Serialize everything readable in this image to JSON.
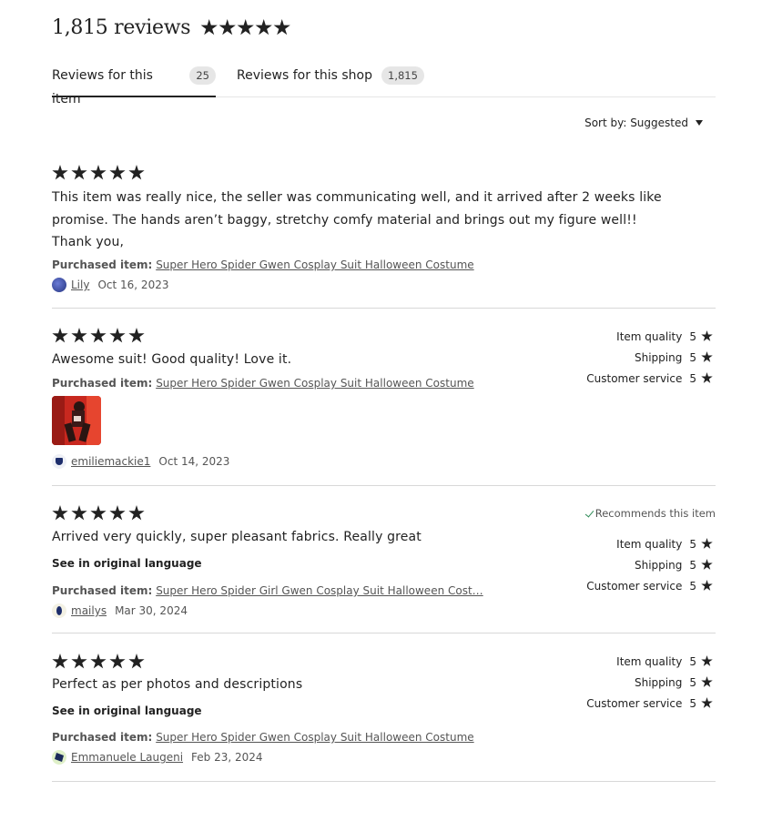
{
  "header": {
    "title": "1,815 reviews"
  },
  "tabs": [
    {
      "label": "Reviews for this item",
      "count": "25"
    },
    {
      "label": "Reviews for this shop",
      "count": "1,815"
    }
  ],
  "sort": {
    "label": "Sort by: Suggested"
  },
  "purchased_label": "Purchased item:",
  "rating_labels": {
    "item_quality": "Item quality",
    "shipping": "Shipping",
    "customer_service": "Customer service"
  },
  "reviews": [
    {
      "stars": 5,
      "text": "This item was really nice, the seller was communicating well, and it arrived after 2 weeks like promise. The hands aren’t baggy, stretchy comfy material and brings out my figure well!! Thank you,",
      "purchased_item": "Super Hero Spider Gwen Cosplay Suit Halloween Costume",
      "user": "Lily",
      "date": "Oct 16, 2023"
    },
    {
      "stars": 5,
      "text": "Awesome suit! Good quality! Love it.",
      "purchased_item": "Super Hero Spider Gwen Cosplay Suit Halloween Costume",
      "user": "emiliemackie1",
      "date": "Oct 14, 2023",
      "ratings": {
        "item_quality": "5",
        "shipping": "5",
        "customer_service": "5"
      }
    },
    {
      "stars": 5,
      "text": "Arrived very quickly, super pleasant fabrics. Really great",
      "see_original": "See in original language",
      "recommends": "Recommends this item",
      "purchased_item": "Super Hero Spider Girl Gwen Cosplay Suit Halloween Cost…",
      "user": "mailys",
      "date": "Mar 30, 2024",
      "ratings": {
        "item_quality": "5",
        "shipping": "5",
        "customer_service": "5"
      }
    },
    {
      "stars": 5,
      "text": "Perfect as per photos and descriptions",
      "see_original": "See in original language",
      "purchased_item": "Super Hero Spider Gwen Cosplay Suit Halloween Costume",
      "user": "Emmanuele Laugeni",
      "date": "Feb 23, 2024",
      "ratings": {
        "item_quality": "5",
        "shipping": "5",
        "customer_service": "5"
      }
    }
  ]
}
